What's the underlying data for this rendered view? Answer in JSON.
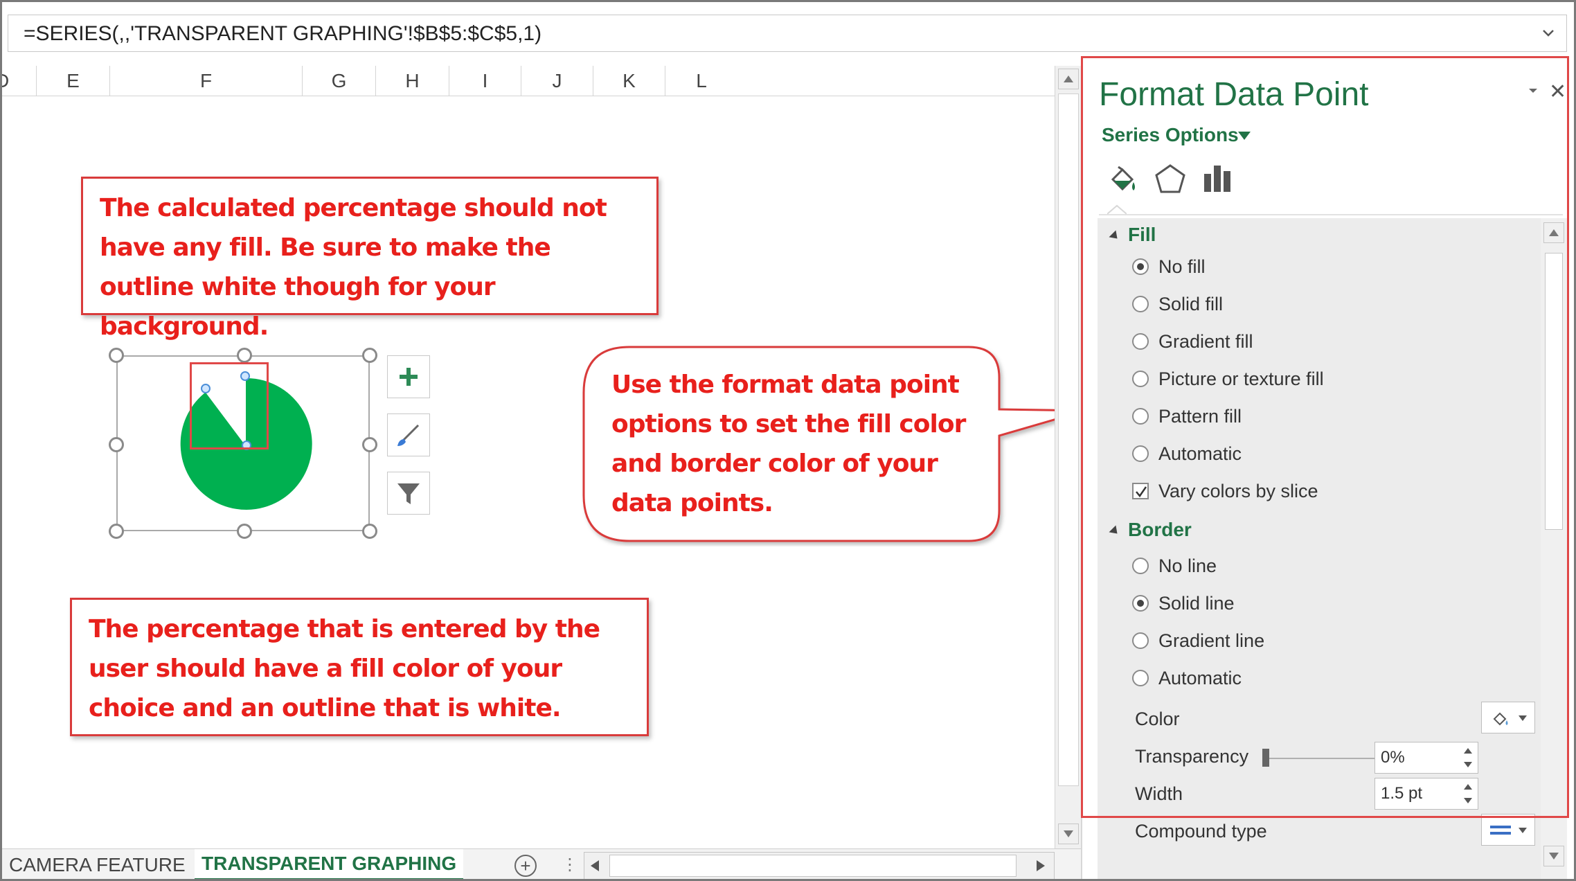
{
  "formula_bar": {
    "text": "=SERIES(,,'TRANSPARENT GRAPHING'!$B$5:$C$5,1)"
  },
  "columns": [
    "D",
    "E",
    "F",
    "G",
    "H",
    "I",
    "J",
    "K",
    "L"
  ],
  "callouts": {
    "top": "The calculated percentage should not have any fill.  Be sure to make the outline white though for your background.",
    "bubble": "Use the format data point options to set the fill color and border color of your data points.",
    "bottom": "The percentage that is entered by the user should have a fill color of your choice and an outline that is white."
  },
  "chart": {
    "slice_color": "#00b050",
    "tools": [
      "plus-icon",
      "brush-icon",
      "filter-icon"
    ]
  },
  "sheet_tabs": {
    "camera": "CAMERA FEATURE",
    "transparent": "TRANSPARENT GRAPHING"
  },
  "pane": {
    "title": "Format Data Point",
    "series_options": "Series Options",
    "fill": {
      "heading": "Fill",
      "options": [
        {
          "label": "No fill",
          "selected": true
        },
        {
          "label": "Solid fill",
          "selected": false
        },
        {
          "label": "Gradient fill",
          "selected": false
        },
        {
          "label": "Picture or texture fill",
          "selected": false
        },
        {
          "label": "Pattern fill",
          "selected": false
        },
        {
          "label": "Automatic",
          "selected": false
        }
      ],
      "vary_colors": {
        "label": "Vary colors by slice",
        "checked": true
      }
    },
    "border": {
      "heading": "Border",
      "options": [
        {
          "label": "No line",
          "selected": false
        },
        {
          "label": "Solid line",
          "selected": true
        },
        {
          "label": "Gradient line",
          "selected": false
        },
        {
          "label": "Automatic",
          "selected": false
        }
      ],
      "color_label": "Color",
      "transparency_label": "Transparency",
      "transparency_value": "0%",
      "width_label": "Width",
      "width_value": "1.5 pt",
      "compound_label": "Compound type"
    }
  },
  "colors": {
    "accent": "#217346",
    "callout_text": "#e8201c",
    "highlight": "#e04848"
  }
}
